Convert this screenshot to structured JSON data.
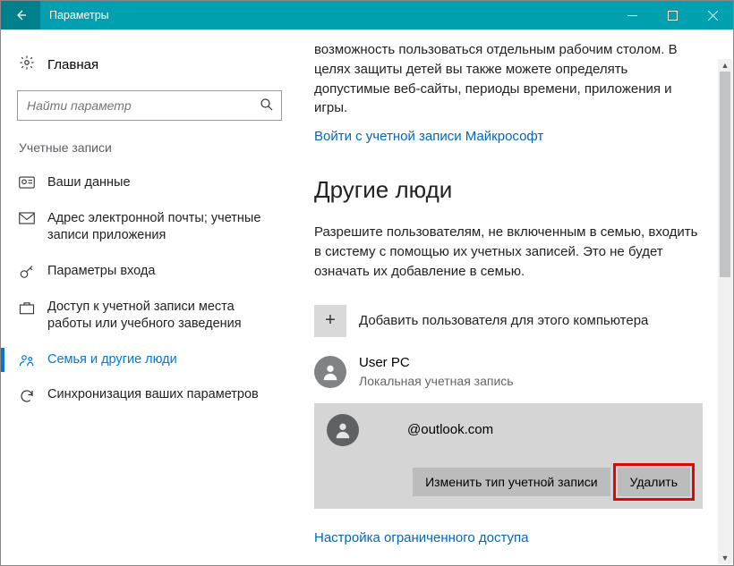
{
  "titlebar": {
    "title": "Параметры"
  },
  "sidebar": {
    "home": "Главная",
    "search_placeholder": "Найти параметр",
    "section": "Учетные записи",
    "items": [
      {
        "label": "Ваши данные"
      },
      {
        "label": "Адрес электронной почты; учетные записи приложения"
      },
      {
        "label": "Параметры входа"
      },
      {
        "label": "Доступ к учетной записи места работы или учебного заведения"
      },
      {
        "label": "Семья и другие люди"
      },
      {
        "label": "Синхронизация ваших параметров"
      }
    ]
  },
  "content": {
    "family_blurb": "возможность пользоваться отдельным рабочим столом. В целях защиты детей вы также можете определять допустимые веб-сайты, периоды времени, приложения и игры.",
    "signin_link": "Войти с учетной записи Майкрософт",
    "others_heading": "Другие люди",
    "others_blurb": "Разрешите пользователям, не включенным в семью, входить в систему с помощью их учетных записей. Это не будет означать их добавление в семью.",
    "add_label": "Добавить пользователя для этого компьютера",
    "user1": {
      "name": "User PC",
      "sub": "Локальная учетная запись"
    },
    "user2": {
      "name": "@outlook.com"
    },
    "change_type_btn": "Изменить тип учетной записи",
    "delete_btn": "Удалить",
    "restricted_link": "Настройка ограниченного доступа"
  }
}
